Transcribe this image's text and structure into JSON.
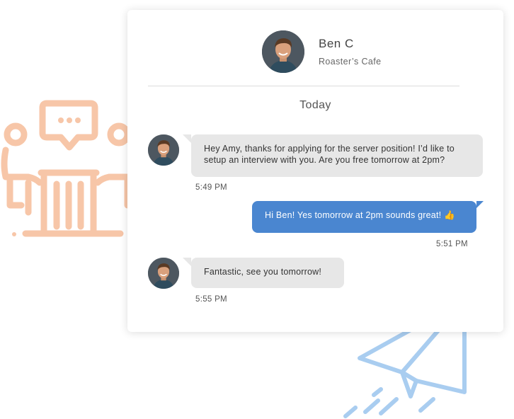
{
  "contact": {
    "name": "Ben C",
    "business": "Roaster’s Cafe",
    "avatar_icon": "profile-photo-avatar"
  },
  "conversation": {
    "date_label": "Today",
    "messages": [
      {
        "direction": "incoming",
        "text": "Hey Amy, thanks for applying for the server position! I’d like to setup an interview with you. Are you free tomorrow at 2pm?",
        "time": "5:49 PM"
      },
      {
        "direction": "outgoing",
        "text": "Hi Ben! Yes tomorrow at 2pm sounds great! 👍",
        "time": "5:51 PM"
      },
      {
        "direction": "incoming",
        "text": "Fantastic, see you tomorrow!",
        "time": "5:55 PM"
      }
    ]
  },
  "decorations": {
    "left_icon": "interview-meeting-icon",
    "bottom_icon": "paper-plane-icon"
  },
  "colors": {
    "outgoing_bubble": "#4a86d0",
    "incoming_bubble": "#e7e7e7",
    "meeting_illustration": "#f7c6a8",
    "paper_plane": "#a9cdf0"
  }
}
